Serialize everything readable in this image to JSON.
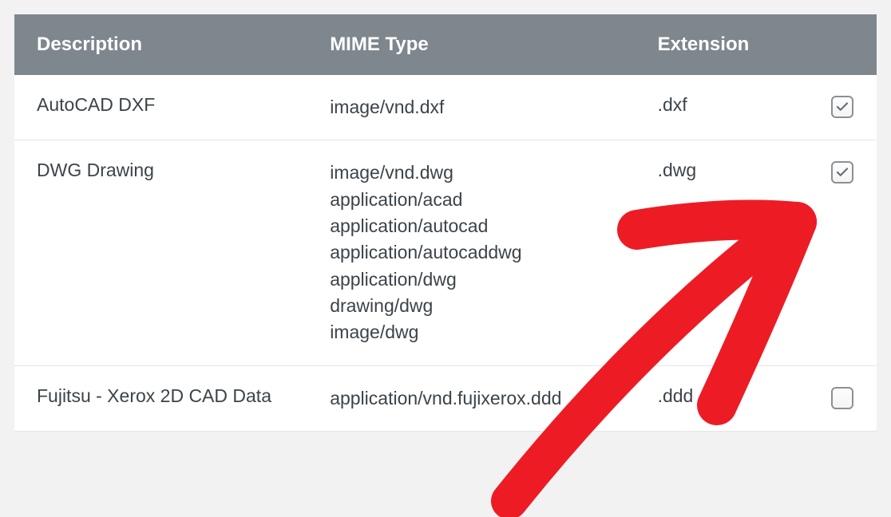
{
  "headers": {
    "description": "Description",
    "mime": "MIME Type",
    "extension": "Extension"
  },
  "rows": [
    {
      "description": "AutoCAD DXF",
      "mime": [
        "image/vnd.dxf"
      ],
      "extension": ".dxf",
      "checked": true
    },
    {
      "description": "DWG Drawing",
      "mime": [
        "image/vnd.dwg",
        "application/acad",
        "application/autocad",
        "application/autocaddwg",
        "application/dwg",
        "drawing/dwg",
        "image/dwg"
      ],
      "extension": ".dwg",
      "checked": true
    },
    {
      "description": "Fujitsu - Xerox 2D CAD Data",
      "mime": [
        "application/vnd.fujixerox.ddd"
      ],
      "extension": ".ddd",
      "checked": false
    }
  ],
  "annotation": {
    "color": "#ed1c24",
    "type": "arrow"
  }
}
